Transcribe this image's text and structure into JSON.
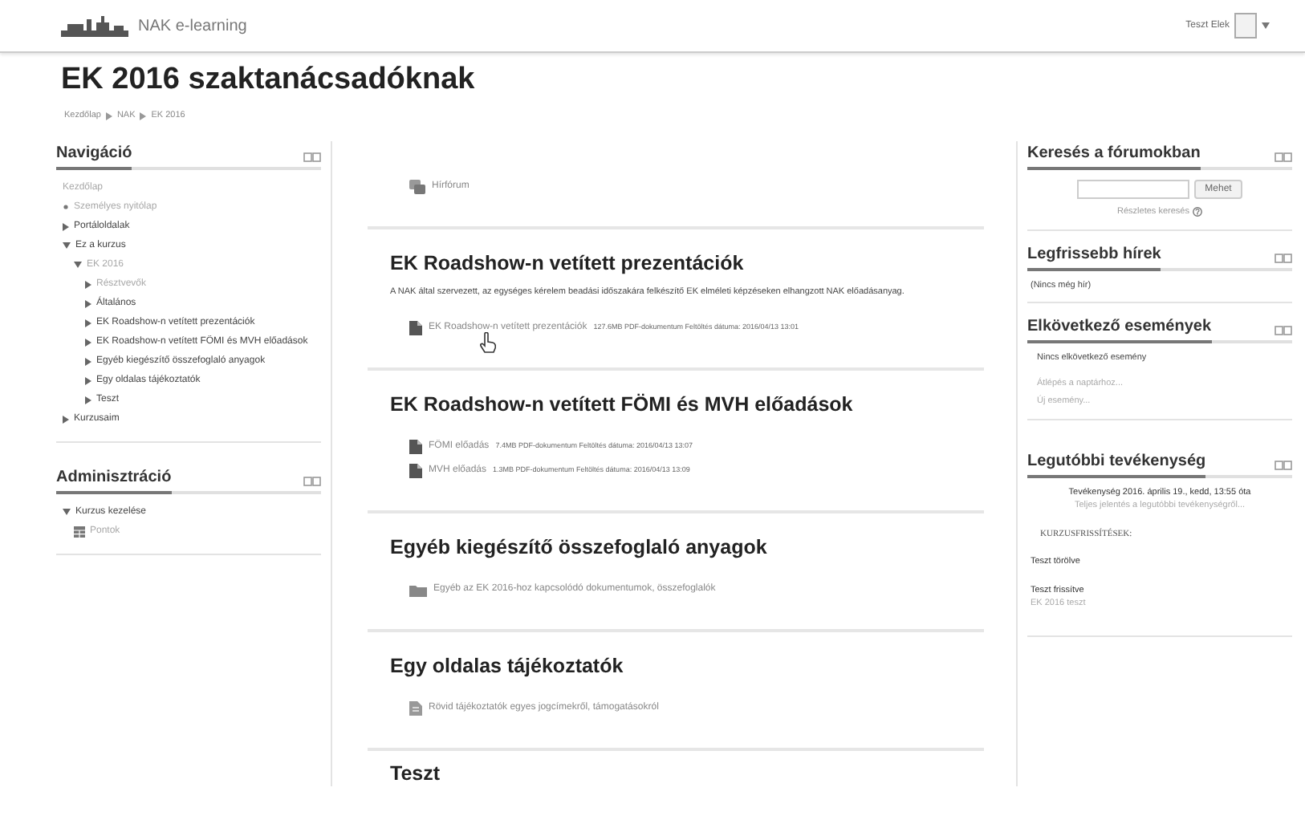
{
  "header": {
    "site_name": "NAK e-learning",
    "user_name": "Teszt Elek"
  },
  "page_title": "EK 2016 szaktanácsadóknak",
  "breadcrumb": [
    "Kezdőlap",
    "NAK",
    "EK 2016"
  ],
  "navigation": {
    "title": "Navigáció",
    "items": [
      {
        "label": "Kezdőlap",
        "kind": "plain",
        "muted": true
      },
      {
        "label": "Személyes nyitólap",
        "kind": "bullet",
        "muted": true
      },
      {
        "label": "Portáloldalak",
        "kind": "branch",
        "expanded": false,
        "muted": false
      },
      {
        "label": "Ez a kurzus",
        "kind": "branch",
        "expanded": true,
        "muted": false,
        "children": [
          {
            "label": "EK 2016",
            "kind": "branch",
            "expanded": true,
            "muted": true,
            "children": [
              {
                "label": "Résztvevők",
                "kind": "branch",
                "expanded": false,
                "muted": true
              },
              {
                "label": "Általános",
                "kind": "branch",
                "expanded": false,
                "muted": false
              },
              {
                "label": "EK Roadshow-n vetített prezentációk",
                "kind": "branch",
                "expanded": false,
                "muted": false
              },
              {
                "label": "EK Roadshow-n vetített FÖMI és MVH előadások",
                "kind": "branch",
                "expanded": false,
                "muted": false
              },
              {
                "label": "Egyéb kiegészítő összefoglaló anyagok",
                "kind": "branch",
                "expanded": false,
                "muted": false
              },
              {
                "label": "Egy oldalas tájékoztatók",
                "kind": "branch",
                "expanded": false,
                "muted": false
              },
              {
                "label": "Teszt",
                "kind": "branch",
                "expanded": false,
                "muted": false
              }
            ]
          }
        ]
      },
      {
        "label": "Kurzusaim",
        "kind": "branch",
        "expanded": false,
        "muted": false
      }
    ]
  },
  "administration": {
    "title": "Adminisztráció",
    "items": [
      {
        "label": "Kurzus kezelése",
        "kind": "branch",
        "expanded": true,
        "muted": false,
        "children": [
          {
            "label": "Pontok",
            "kind": "grades",
            "muted": true
          }
        ]
      }
    ]
  },
  "sections": [
    {
      "activities": [
        {
          "kind": "forum",
          "name": "Hírfórum"
        }
      ]
    },
    {
      "title": "EK Roadshow-n vetített prezentációk",
      "summary": "A NAK által szervezett, az egységes kérelem beadási időszakára felkészítő EK elméleti képzéseken elhangzott NAK előadásanyag.",
      "activities": [
        {
          "kind": "pdf",
          "name": "EK Roadshow-n vetített prezentációk",
          "details": "127.6MB PDF-dokumentum Feltöltés dátuma: 2016/04/13 13:01",
          "pointer": true
        }
      ]
    },
    {
      "title": "EK Roadshow-n vetített FÖMI és MVH előadások",
      "activities": [
        {
          "kind": "pdf",
          "name": "FÖMI előadás",
          "details": "7.4MB PDF-dokumentum Feltöltés dátuma: 2016/04/13 13:07",
          "pointer": false
        },
        {
          "kind": "pdf",
          "name": "MVH előadás",
          "details": "1.3MB PDF-dokumentum Feltöltés dátuma: 2016/04/13 13:09",
          "pointer": false
        }
      ]
    },
    {
      "title": "Egyéb kiegészítő összefoglaló anyagok",
      "activities": [
        {
          "kind": "folder",
          "name": "Egyéb az EK 2016-hoz kapcsolódó dokumentumok, összefoglalók"
        }
      ]
    },
    {
      "title": "Egy oldalas tájékoztatók",
      "activities": [
        {
          "kind": "page",
          "name": "Rövid tájékoztatók egyes jogcímekről, támogatásokról"
        }
      ]
    },
    {
      "title": "Teszt"
    }
  ],
  "blocks": [
    {
      "kind": "search",
      "title": "Keresés a fórumokban",
      "button": "Mehet",
      "link": "Részletes keresés"
    },
    {
      "kind": "news",
      "title": "Legfrissebb hírek",
      "text": "(Nincs még hír)"
    },
    {
      "kind": "events",
      "title": "Elkövetkező események",
      "text": "Nincs elkövetkező esemény",
      "links": [
        "Átlépés a naptárhoz...",
        "Új esemény..."
      ]
    },
    {
      "kind": "recent",
      "title": "Legutóbbi tevékenység",
      "since": "Tevékenység 2016. április 19., kedd, 13:55 óta",
      "report_link": "Teljes jelentés a legutóbbi tevékenységről...",
      "heading": "KURZUSFRISSÍTÉSEK:",
      "entries": [
        {
          "text": "Teszt törölve"
        },
        {
          "text": "Teszt frissítve",
          "link": "EK 2016 teszt"
        }
      ]
    }
  ]
}
